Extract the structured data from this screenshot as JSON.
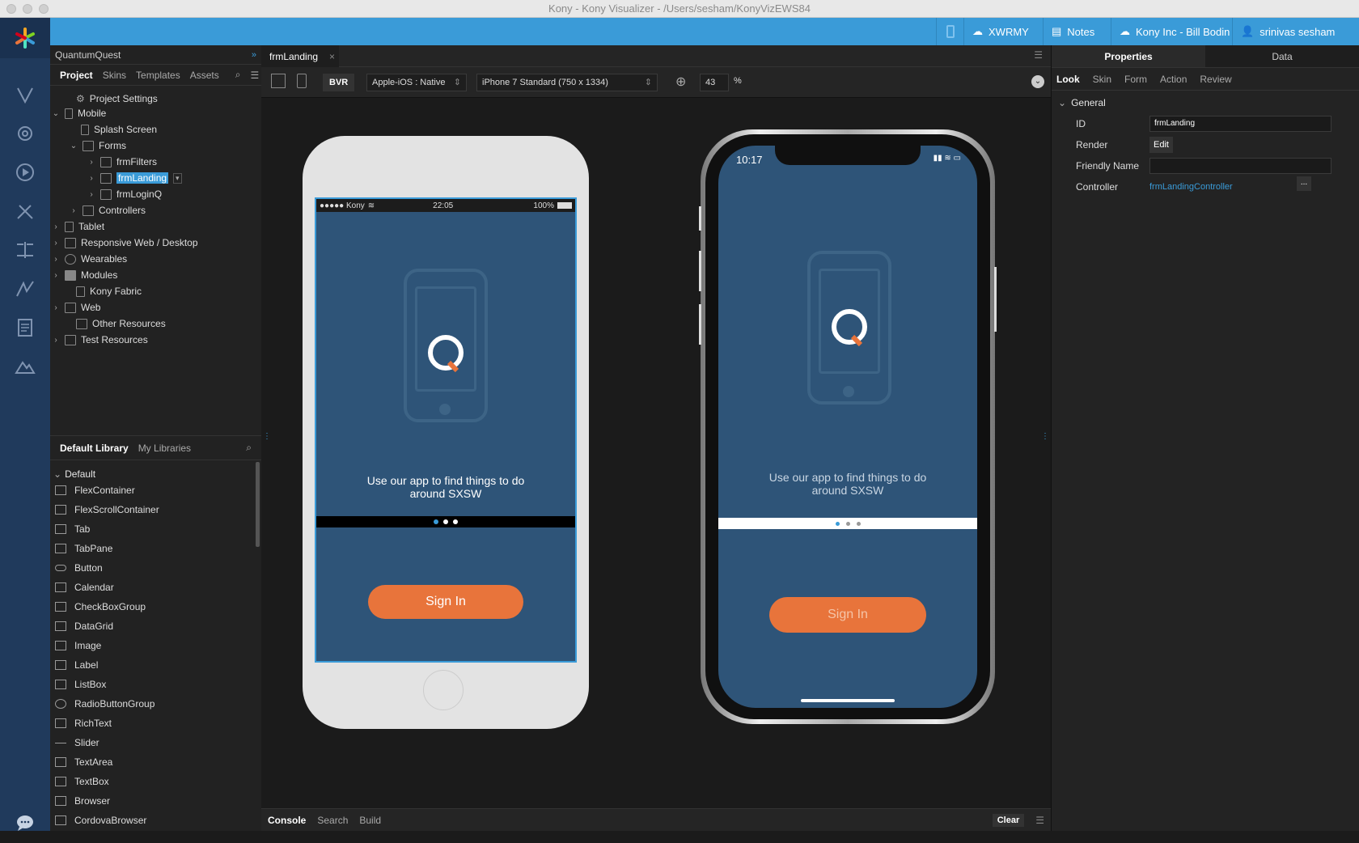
{
  "window": {
    "title": "Kony - Kony Visualizer - /Users/sesham/KonyVizEWS84"
  },
  "topbar": {
    "items": [
      {
        "label": "XWRMY",
        "icon": "cloud-icon"
      },
      {
        "label": "Notes",
        "icon": "notes-icon"
      },
      {
        "label": "Kony Inc - Bill Bodin",
        "icon": "cloud-icon"
      },
      {
        "label": "srinivas sesham",
        "icon": "user-icon"
      }
    ]
  },
  "project": {
    "name": "QuantumQuest",
    "tabs": [
      "Project",
      "Skins",
      "Templates",
      "Assets"
    ],
    "tree": [
      {
        "label": "Project Settings"
      },
      {
        "label": "Mobile"
      },
      {
        "label": "Splash Screen"
      },
      {
        "label": "Forms"
      },
      {
        "label": "frmFilters"
      },
      {
        "label": "frmLanding"
      },
      {
        "label": "frmLoginQ"
      },
      {
        "label": "Controllers"
      },
      {
        "label": "Tablet"
      },
      {
        "label": "Responsive Web / Desktop"
      },
      {
        "label": "Wearables"
      },
      {
        "label": "Modules"
      },
      {
        "label": "Kony Fabric"
      },
      {
        "label": "Web"
      },
      {
        "label": "Other Resources"
      },
      {
        "label": "Test Resources"
      }
    ]
  },
  "library": {
    "tabs": [
      "Default Library",
      "My Libraries"
    ],
    "group": "Default",
    "items": [
      "FlexContainer",
      "FlexScrollContainer",
      "Tab",
      "TabPane",
      "Button",
      "Calendar",
      "CheckBoxGroup",
      "DataGrid",
      "Image",
      "Label",
      "ListBox",
      "RadioButtonGroup",
      "RichText",
      "Slider",
      "TextArea",
      "TextBox",
      "Browser",
      "CordovaBrowser"
    ]
  },
  "editor": {
    "tab": "frmLanding",
    "bvr": "BVR",
    "platform": "Apple-iOS : Native",
    "device": "iPhone 7 Standard (750 x 1334)",
    "zoom": "43",
    "zoom_unit": "%"
  },
  "preview": {
    "status_carrier": "●●●●● Kony",
    "status_time": "22:05",
    "status_battery": "100%",
    "x_time": "10:17",
    "caption": "Use our app to find things to do around SXSW",
    "signin": "Sign In"
  },
  "console": {
    "tabs": [
      "Console",
      "Search",
      "Build"
    ],
    "clear": "Clear"
  },
  "properties": {
    "tabs": [
      "Properties",
      "Data"
    ],
    "subtabs": [
      "Look",
      "Skin",
      "Form",
      "Action",
      "Review"
    ],
    "section": "General",
    "id_label": "ID",
    "id_value": "frmLanding",
    "render_label": "Render",
    "render_button": "Edit",
    "friendly_label": "Friendly Name",
    "friendly_value": "",
    "controller_label": "Controller",
    "controller_value": "frmLandingController",
    "more_button": "...",
    "accent": "#3a9bd8",
    "link_color": "#3a9bd8"
  }
}
